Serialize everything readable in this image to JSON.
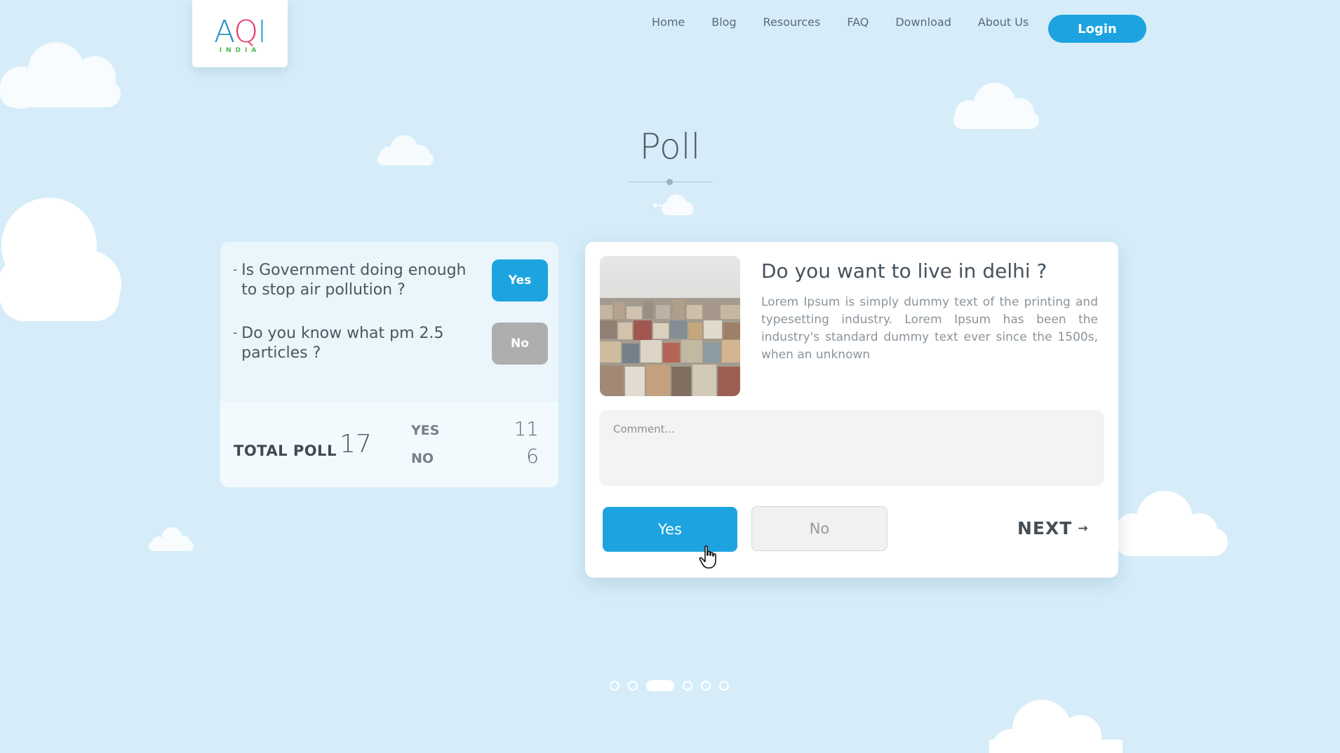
{
  "logo": {
    "part_a": "A",
    "part_q": "Q",
    "part_i": "I",
    "sub": "INDIA"
  },
  "nav": {
    "items": [
      {
        "label": "Home"
      },
      {
        "label": "Blog"
      },
      {
        "label": "Resources"
      },
      {
        "label": "FAQ"
      },
      {
        "label": "Download"
      },
      {
        "label": "About Us"
      }
    ],
    "login_label": "Login"
  },
  "page_title": "Poll",
  "left_card": {
    "questions": [
      {
        "text": "Is Government doing enough to stop air pollution ?",
        "answer": "Yes"
      },
      {
        "text": "Do you know what pm 2.5 particles ?",
        "answer": "No"
      }
    ],
    "stats": {
      "total_label": "TOTAL POLL",
      "total_value": "17",
      "yes_label": "YES",
      "yes_value": "11",
      "no_label": "NO",
      "no_value": "6"
    }
  },
  "right_card": {
    "title": "Do you want to live in delhi ?",
    "description": "Lorem Ipsum is simply dummy text of the printing and typesetting industry. Lorem Ipsum has been the industry's standard dummy text ever since the 1500s, when an unknown",
    "comment_placeholder": "Comment...",
    "yes_label": "Yes",
    "no_label": "No",
    "next_label": "NEXT",
    "next_arrow": "→"
  },
  "pagination": {
    "count": 6,
    "active_index": 2
  },
  "colors": {
    "background": "#d6edf9",
    "accent": "#1da4e0",
    "no_gray": "#aeaeae"
  }
}
